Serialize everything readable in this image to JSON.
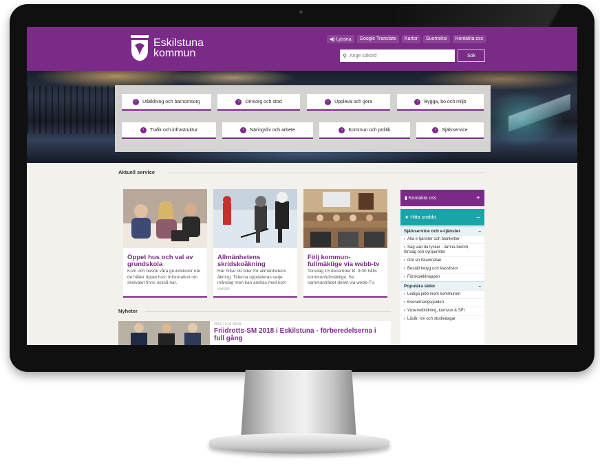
{
  "header": {
    "logo_line1": "Eskilstuna",
    "logo_line2": "kommun",
    "top_links": [
      "Lyssna",
      "Google Translate",
      "Kartor",
      "Suomeksi",
      "Kontakta oss"
    ],
    "search_placeholder": "Ange sökord",
    "search_button": "Sök"
  },
  "nav": {
    "row1": [
      "Utbildning och barnomsorg",
      "Omsorg och stöd",
      "Uppleva och göra",
      "Bygga, bo och miljö"
    ],
    "row2": [
      "Trafik och infrastruktur",
      "Näringsliv och arbete",
      "Kommun och politik",
      "Självservice"
    ]
  },
  "current_service": {
    "title": "Aktuell service",
    "cards": [
      {
        "title": "Öppet hus och val av grundskola",
        "text": "Kom och besök våra grundskolor när de håller öppet hus! Information om skolvalet finns också här."
      },
      {
        "title": "Allmänhetens skridskoåkning",
        "text": "Här hittar du tider för allmänhetens åkning. Tiderna uppdateras varje måndag men kan ändras med kort varsel."
      },
      {
        "title": "Följ kommun-fullmäktige via webb-tv",
        "text": "Torsdag 15 december kl. 9.00 hålls kommunfullmäktige. Se sammanträdet direkt via webb-TV."
      }
    ]
  },
  "sidebar": {
    "contact_label": "Kontakta oss",
    "find_label": "Hitta snabbt",
    "groups": [
      {
        "title": "Självservice och e-tjänster",
        "items": [
          "Alla e-tjänster och blanketter",
          "Säg vad du tycker - lämna beröm, förslag och synpunkter",
          "Gör en felanmälan",
          "Beställ betyg och klasslistor",
          "Förskoleklnappen"
        ]
      },
      {
        "title": "Populära sidor",
        "items": [
          "Lediga jobb inom kommunen",
          "Evenemangsguiden",
          "Vuxenutbildning, komvux & SFI",
          "Läsår, lov och studiedagar"
        ]
      }
    ]
  },
  "news": {
    "title": "Nyheter",
    "items": [
      {
        "date": "2016-12-02 09:09",
        "title": "Friidrotts-SM 2018 i Eskilstuna - förberedelserna i full gång"
      }
    ]
  },
  "colors": {
    "brand_purple": "#7b2a88",
    "teal": "#1aa3a8",
    "page_bg": "#f3f1ec"
  }
}
